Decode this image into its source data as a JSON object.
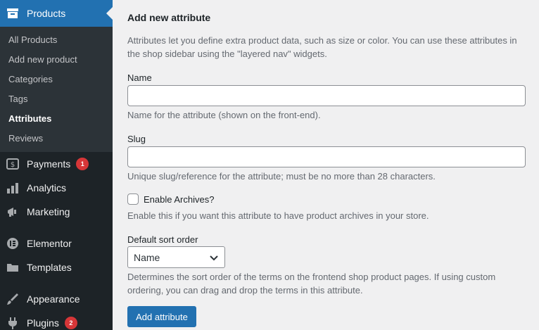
{
  "sidebar": {
    "products": {
      "label": "Products",
      "icon": "products-icon"
    },
    "submenu": [
      {
        "label": "All Products"
      },
      {
        "label": "Add new product"
      },
      {
        "label": "Categories"
      },
      {
        "label": "Tags"
      },
      {
        "label": "Attributes",
        "current": true
      },
      {
        "label": "Reviews"
      }
    ],
    "items": [
      {
        "label": "Payments",
        "icon": "payments-icon",
        "badge": "1"
      },
      {
        "label": "Analytics",
        "icon": "analytics-icon"
      },
      {
        "label": "Marketing",
        "icon": "megaphone-icon"
      },
      {
        "label": "Elementor",
        "icon": "elementor-icon"
      },
      {
        "label": "Templates",
        "icon": "folder-icon"
      },
      {
        "label": "Appearance",
        "icon": "paintbrush-icon"
      },
      {
        "label": "Plugins",
        "icon": "plugin-icon",
        "badge": "2"
      }
    ]
  },
  "form": {
    "title": "Add new attribute",
    "intro": "Attributes let you define extra product data, such as size or color. You can use these attributes in the shop sidebar using the \"layered nav\" widgets.",
    "name_label": "Name",
    "name_value": "",
    "name_desc": "Name for the attribute (shown on the front-end).",
    "slug_label": "Slug",
    "slug_value": "",
    "slug_desc": "Unique slug/reference for the attribute; must be no more than 28 characters.",
    "archives_label": "Enable Archives?",
    "archives_desc": "Enable this if you want this attribute to have product archives in your store.",
    "sort_label": "Default sort order",
    "sort_value": "Name",
    "sort_desc": "Determines the sort order of the terms on the frontend shop product pages. If using custom ordering, you can drag and drop the terms in this attribute.",
    "submit_label": "Add attribute"
  },
  "colors": {
    "accent": "#2271b1",
    "sidebar": "#1d2327",
    "badge": "#d63638"
  }
}
